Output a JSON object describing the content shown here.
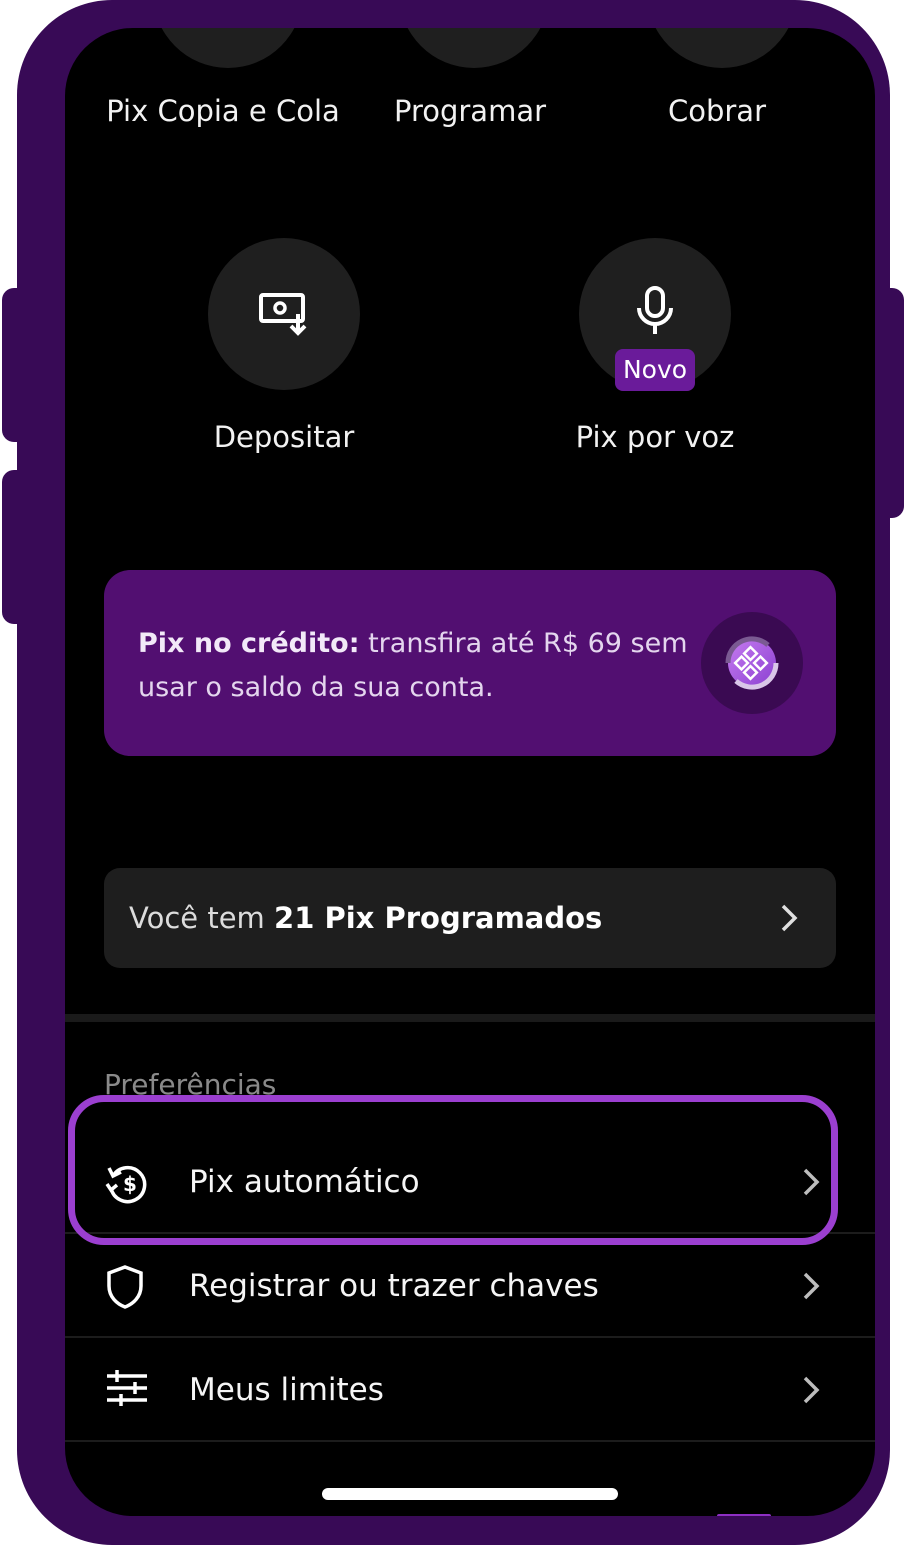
{
  "top_actions": [
    {
      "label": "Pix Copia e Cola"
    },
    {
      "label": "Programar"
    },
    {
      "label": "Cobrar"
    }
  ],
  "actions": {
    "depositar": {
      "label": "Depositar",
      "icon": "deposit-icon"
    },
    "pix_voz": {
      "label": "Pix por voz",
      "icon": "microphone-icon",
      "badge": "Novo"
    }
  },
  "promo": {
    "bold": "Pix no crédito:",
    "text": " transfira até R$ 69 sem usar o saldo da sua conta.",
    "icon": "pix-credit-icon"
  },
  "programados": {
    "prefix": "Você tem ",
    "bold": "21 Pix Programados"
  },
  "preferences": {
    "title": "Preferências",
    "items": [
      {
        "label": "Pix automático",
        "icon": "recurring-money-icon"
      },
      {
        "label": "Registrar ou trazer chaves",
        "icon": "shield-icon"
      },
      {
        "label": "Meus limites",
        "icon": "sliders-icon"
      }
    ]
  },
  "colors": {
    "frame": "#380a56",
    "accent": "#520f71",
    "badge": "#6a1b9a",
    "highlight": "#9b3fd0"
  }
}
